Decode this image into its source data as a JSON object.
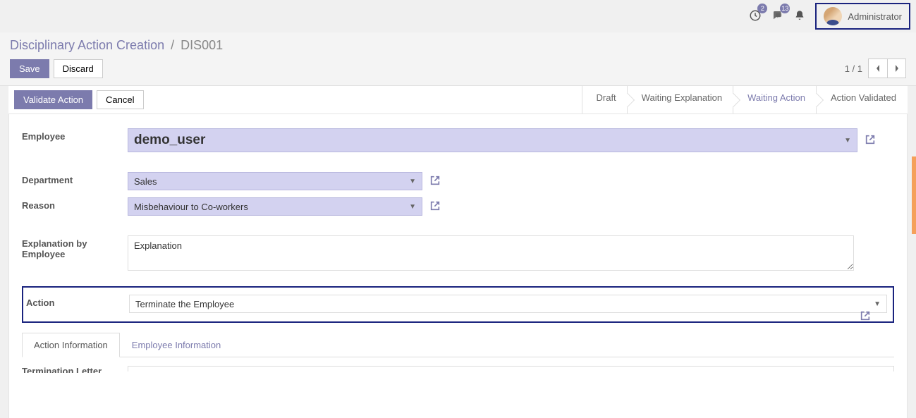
{
  "topbar": {
    "clock_badge": "2",
    "chat_badge": "13",
    "user_name": "Administrator"
  },
  "breadcrumb": {
    "title": "Disciplinary Action Creation",
    "current": "DIS001",
    "sep": "/"
  },
  "header_buttons": {
    "save": "Save",
    "discard": "Discard"
  },
  "pager": {
    "text": "1 / 1"
  },
  "actionbar": {
    "validate": "Validate Action",
    "cancel": "Cancel"
  },
  "status": {
    "draft": "Draft",
    "waiting_explanation": "Waiting Explanation",
    "waiting_action": "Waiting Action",
    "action_validated": "Action Validated"
  },
  "form": {
    "employee_label": "Employee",
    "employee_value": "demo_user",
    "department_label": "Department",
    "department_value": "Sales",
    "reason_label": "Reason",
    "reason_value": "Misbehaviour to Co-workers",
    "explanation_label": "Explanation by Employee",
    "explanation_value": "Explanation",
    "action_label": "Action",
    "action_value": "Terminate the Employee",
    "termination_label": "Termination Letter"
  },
  "tabs": {
    "action_info": "Action Information",
    "employee_info": "Employee Information"
  }
}
